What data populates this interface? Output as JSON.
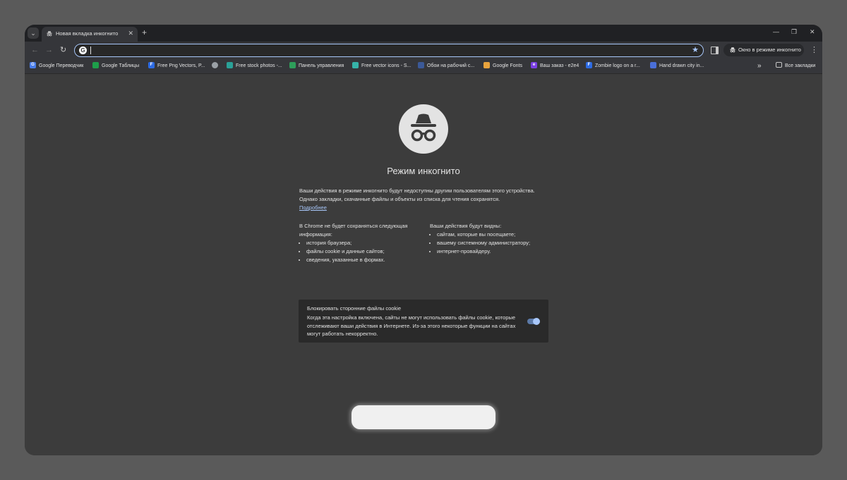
{
  "tab": {
    "title": "Новая вкладка инкогнито"
  },
  "toolbar": {
    "omnibox_value": "",
    "incognito_chip_label": "Окно в режиме инкогнито"
  },
  "bookmarks": [
    {
      "label": "Google Переводчик",
      "fav": "G",
      "color": "#4a7de8"
    },
    {
      "label": "Google Таблицы",
      "fav": "",
      "color": "#1e9e4a"
    },
    {
      "label": "Free Png Vectors, P...",
      "fav": "F",
      "color": "#2d6be4"
    },
    {
      "label": "",
      "fav": "",
      "color": "#9aa0a6"
    },
    {
      "label": "Free stock photos -...",
      "fav": "",
      "color": "#2aa198"
    },
    {
      "label": "Панель управления",
      "fav": "",
      "color": "#2e9e5a"
    },
    {
      "label": "Free vector icons - S...",
      "fav": "",
      "color": "#36b3a8"
    },
    {
      "label": "Обои на рабочий с...",
      "fav": "",
      "color": "#3b5998"
    },
    {
      "label": "Google Fonts",
      "fav": "",
      "color": "#e8a33d"
    },
    {
      "label": "Ваш заказ - e2e4",
      "fav": "e",
      "color": "#7b3fe4"
    },
    {
      "label": "Zombie logo on a r...",
      "fav": "F",
      "color": "#2d6be4"
    },
    {
      "label": "Hand drawn city in...",
      "fav": "",
      "color": "#4a6fd8"
    }
  ],
  "bookmarks_more": "»",
  "all_bookmarks": "Все закладки",
  "incognito": {
    "title": "Режим инкогнито",
    "intro": "Ваши действия в режиме инкогнито будут недоступны другим пользователям этого устройства. Однако закладки, скачанные файлы и объекты из списка для чтения сохранятся.",
    "learn_more": "Подробнее",
    "not_saved_heading": "В Chrome не будет сохраняться следующая информация:",
    "not_saved_items": [
      "история браузера;",
      "файлы cookie и данные сайтов;",
      "сведения, указанные в формах."
    ],
    "visible_heading": "Ваши действия будут видны:",
    "visible_items": [
      "сайтам, которые вы посещаете;",
      "вашему системному администратору;",
      "интернет-провайдеру."
    ],
    "cookie_title": "Блокировать сторонние файлы cookie",
    "cookie_desc": "Когда эта настройка включена, сайты не могут использовать файлы cookie, которые отслеживают ваши действия в Интернете. Из-за этого некоторые функции на сайтах могут работать некорректно.",
    "cookie_toggle_on": true
  },
  "colors": {
    "accent": "#a8c7fa",
    "background": "#3c3c3c",
    "frame": "#202124"
  },
  "icons": {
    "tab_search": "chevron-down-icon",
    "new_tab": "plus-icon",
    "back": "arrow-left-icon",
    "forward": "arrow-right-icon",
    "reload": "reload-icon",
    "bookmark_star": "star-icon",
    "menu": "three-dots-icon",
    "incognito": "incognito-icon"
  }
}
